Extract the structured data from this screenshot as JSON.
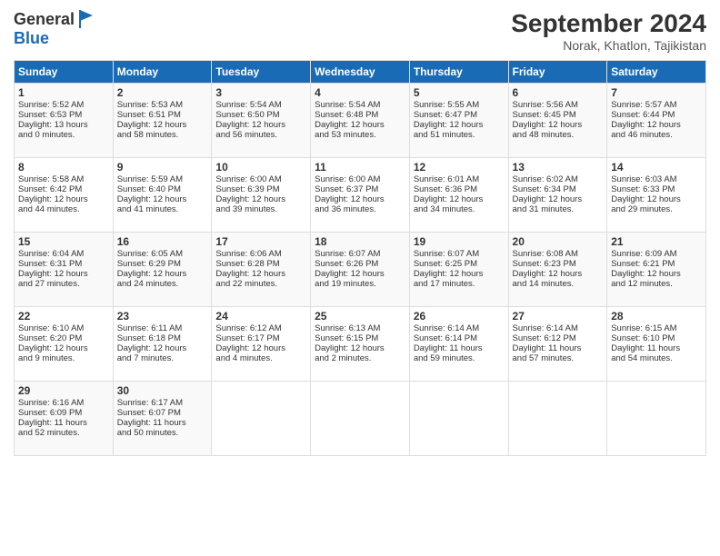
{
  "header": {
    "logo_line1": "General",
    "logo_line2": "Blue",
    "month": "September 2024",
    "location": "Norak, Khatlon, Tajikistan"
  },
  "days_of_week": [
    "Sunday",
    "Monday",
    "Tuesday",
    "Wednesday",
    "Thursday",
    "Friday",
    "Saturday"
  ],
  "weeks": [
    [
      {
        "day": "1",
        "lines": [
          "Sunrise: 5:52 AM",
          "Sunset: 6:53 PM",
          "Daylight: 13 hours",
          "and 0 minutes."
        ]
      },
      {
        "day": "2",
        "lines": [
          "Sunrise: 5:53 AM",
          "Sunset: 6:51 PM",
          "Daylight: 12 hours",
          "and 58 minutes."
        ]
      },
      {
        "day": "3",
        "lines": [
          "Sunrise: 5:54 AM",
          "Sunset: 6:50 PM",
          "Daylight: 12 hours",
          "and 56 minutes."
        ]
      },
      {
        "day": "4",
        "lines": [
          "Sunrise: 5:54 AM",
          "Sunset: 6:48 PM",
          "Daylight: 12 hours",
          "and 53 minutes."
        ]
      },
      {
        "day": "5",
        "lines": [
          "Sunrise: 5:55 AM",
          "Sunset: 6:47 PM",
          "Daylight: 12 hours",
          "and 51 minutes."
        ]
      },
      {
        "day": "6",
        "lines": [
          "Sunrise: 5:56 AM",
          "Sunset: 6:45 PM",
          "Daylight: 12 hours",
          "and 48 minutes."
        ]
      },
      {
        "day": "7",
        "lines": [
          "Sunrise: 5:57 AM",
          "Sunset: 6:44 PM",
          "Daylight: 12 hours",
          "and 46 minutes."
        ]
      }
    ],
    [
      {
        "day": "8",
        "lines": [
          "Sunrise: 5:58 AM",
          "Sunset: 6:42 PM",
          "Daylight: 12 hours",
          "and 44 minutes."
        ]
      },
      {
        "day": "9",
        "lines": [
          "Sunrise: 5:59 AM",
          "Sunset: 6:40 PM",
          "Daylight: 12 hours",
          "and 41 minutes."
        ]
      },
      {
        "day": "10",
        "lines": [
          "Sunrise: 6:00 AM",
          "Sunset: 6:39 PM",
          "Daylight: 12 hours",
          "and 39 minutes."
        ]
      },
      {
        "day": "11",
        "lines": [
          "Sunrise: 6:00 AM",
          "Sunset: 6:37 PM",
          "Daylight: 12 hours",
          "and 36 minutes."
        ]
      },
      {
        "day": "12",
        "lines": [
          "Sunrise: 6:01 AM",
          "Sunset: 6:36 PM",
          "Daylight: 12 hours",
          "and 34 minutes."
        ]
      },
      {
        "day": "13",
        "lines": [
          "Sunrise: 6:02 AM",
          "Sunset: 6:34 PM",
          "Daylight: 12 hours",
          "and 31 minutes."
        ]
      },
      {
        "day": "14",
        "lines": [
          "Sunrise: 6:03 AM",
          "Sunset: 6:33 PM",
          "Daylight: 12 hours",
          "and 29 minutes."
        ]
      }
    ],
    [
      {
        "day": "15",
        "lines": [
          "Sunrise: 6:04 AM",
          "Sunset: 6:31 PM",
          "Daylight: 12 hours",
          "and 27 minutes."
        ]
      },
      {
        "day": "16",
        "lines": [
          "Sunrise: 6:05 AM",
          "Sunset: 6:29 PM",
          "Daylight: 12 hours",
          "and 24 minutes."
        ]
      },
      {
        "day": "17",
        "lines": [
          "Sunrise: 6:06 AM",
          "Sunset: 6:28 PM",
          "Daylight: 12 hours",
          "and 22 minutes."
        ]
      },
      {
        "day": "18",
        "lines": [
          "Sunrise: 6:07 AM",
          "Sunset: 6:26 PM",
          "Daylight: 12 hours",
          "and 19 minutes."
        ]
      },
      {
        "day": "19",
        "lines": [
          "Sunrise: 6:07 AM",
          "Sunset: 6:25 PM",
          "Daylight: 12 hours",
          "and 17 minutes."
        ]
      },
      {
        "day": "20",
        "lines": [
          "Sunrise: 6:08 AM",
          "Sunset: 6:23 PM",
          "Daylight: 12 hours",
          "and 14 minutes."
        ]
      },
      {
        "day": "21",
        "lines": [
          "Sunrise: 6:09 AM",
          "Sunset: 6:21 PM",
          "Daylight: 12 hours",
          "and 12 minutes."
        ]
      }
    ],
    [
      {
        "day": "22",
        "lines": [
          "Sunrise: 6:10 AM",
          "Sunset: 6:20 PM",
          "Daylight: 12 hours",
          "and 9 minutes."
        ]
      },
      {
        "day": "23",
        "lines": [
          "Sunrise: 6:11 AM",
          "Sunset: 6:18 PM",
          "Daylight: 12 hours",
          "and 7 minutes."
        ]
      },
      {
        "day": "24",
        "lines": [
          "Sunrise: 6:12 AM",
          "Sunset: 6:17 PM",
          "Daylight: 12 hours",
          "and 4 minutes."
        ]
      },
      {
        "day": "25",
        "lines": [
          "Sunrise: 6:13 AM",
          "Sunset: 6:15 PM",
          "Daylight: 12 hours",
          "and 2 minutes."
        ]
      },
      {
        "day": "26",
        "lines": [
          "Sunrise: 6:14 AM",
          "Sunset: 6:14 PM",
          "Daylight: 11 hours",
          "and 59 minutes."
        ]
      },
      {
        "day": "27",
        "lines": [
          "Sunrise: 6:14 AM",
          "Sunset: 6:12 PM",
          "Daylight: 11 hours",
          "and 57 minutes."
        ]
      },
      {
        "day": "28",
        "lines": [
          "Sunrise: 6:15 AM",
          "Sunset: 6:10 PM",
          "Daylight: 11 hours",
          "and 54 minutes."
        ]
      }
    ],
    [
      {
        "day": "29",
        "lines": [
          "Sunrise: 6:16 AM",
          "Sunset: 6:09 PM",
          "Daylight: 11 hours",
          "and 52 minutes."
        ]
      },
      {
        "day": "30",
        "lines": [
          "Sunrise: 6:17 AM",
          "Sunset: 6:07 PM",
          "Daylight: 11 hours",
          "and 50 minutes."
        ]
      },
      {
        "day": "",
        "lines": []
      },
      {
        "day": "",
        "lines": []
      },
      {
        "day": "",
        "lines": []
      },
      {
        "day": "",
        "lines": []
      },
      {
        "day": "",
        "lines": []
      }
    ]
  ]
}
